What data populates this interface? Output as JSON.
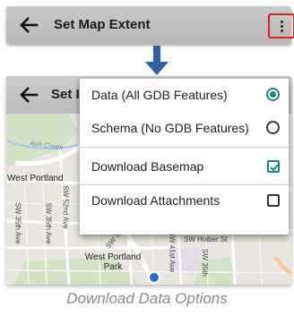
{
  "top_bar": {
    "back_icon": "arrow-left-icon",
    "title": "Set Map Extent",
    "more_icon": "more-vertical-icon",
    "highlight_color": "#e0201a"
  },
  "connector": {
    "icon": "arrow-down-icon",
    "color": "#2e5fa3"
  },
  "screen2": {
    "back_icon": "arrow-left-icon",
    "title_partial": "Set I"
  },
  "map": {
    "labels": {
      "crest": "Ash Creek",
      "west_portland": "West Portland",
      "sw_35th_1": "SW 35th Ave",
      "sw_52nd": "SW 52nd Ave",
      "sw_35th_2": "SW 35th Ave",
      "sw_ter": "SW Ter",
      "sw_hoiber": "SW Hoiber St",
      "sw_41st": "SW 41st Ave",
      "sw_35th_3": "SW 35th",
      "west_portland_park": "West Portland Park"
    }
  },
  "menu": {
    "items": [
      {
        "label": "Data (All GDB Features)",
        "control": "radio",
        "checked": true
      },
      {
        "label": "Schema (No GDB Features)",
        "control": "radio",
        "checked": false
      },
      {
        "label": "Download Basemap",
        "control": "checkbox",
        "checked": true
      },
      {
        "label": "Download Attachments",
        "control": "checkbox",
        "checked": false
      }
    ],
    "accent_color": "#17897d"
  },
  "caption": "Download Data Options"
}
